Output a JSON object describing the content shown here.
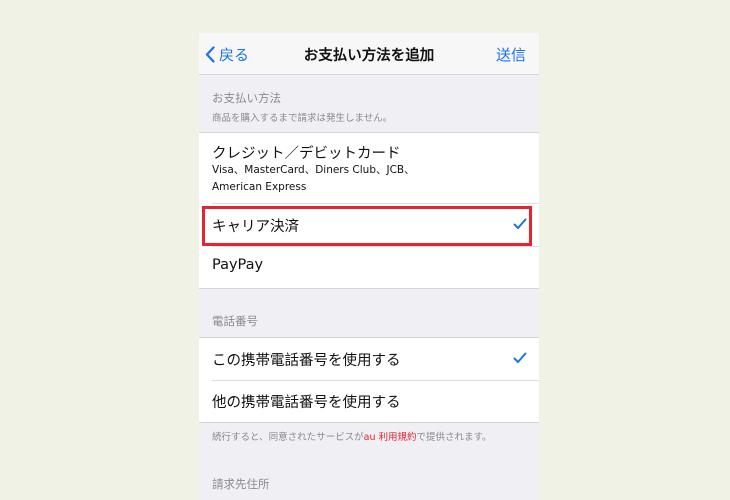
{
  "nav": {
    "back_label": "戻る",
    "title": "お支払い方法を追加",
    "send_label": "送信"
  },
  "payment": {
    "header": "お支払い方法",
    "subheader": "商品を購入するまで請求は発生しません。",
    "options": [
      {
        "label": "クレジット／デビットカード",
        "detail_line1": "Visa、MasterCard、Diners Club、JCB、",
        "detail_line2": "American Express",
        "selected": false
      },
      {
        "label": "キャリア決済",
        "selected": true
      },
      {
        "label": "PayPay",
        "selected": false
      }
    ]
  },
  "phone_number": {
    "header": "電話番号",
    "options": [
      {
        "label": "この携帯電話番号を使用する",
        "selected": true
      },
      {
        "label": "他の携帯電話番号を使用する",
        "selected": false
      }
    ],
    "note_prefix": "続行すると、同意されたサービスが",
    "note_link": "au 利用規約",
    "note_suffix": "で提供されます。"
  },
  "billing": {
    "header": "請求先住所"
  },
  "colors": {
    "accent": "#1a73e8",
    "highlight": "#e5242f",
    "page_background": "#f0f2e6",
    "grouped_background": "#efeff4"
  },
  "icons": {
    "back": "chevron-left-icon",
    "check": "checkmark-icon"
  }
}
